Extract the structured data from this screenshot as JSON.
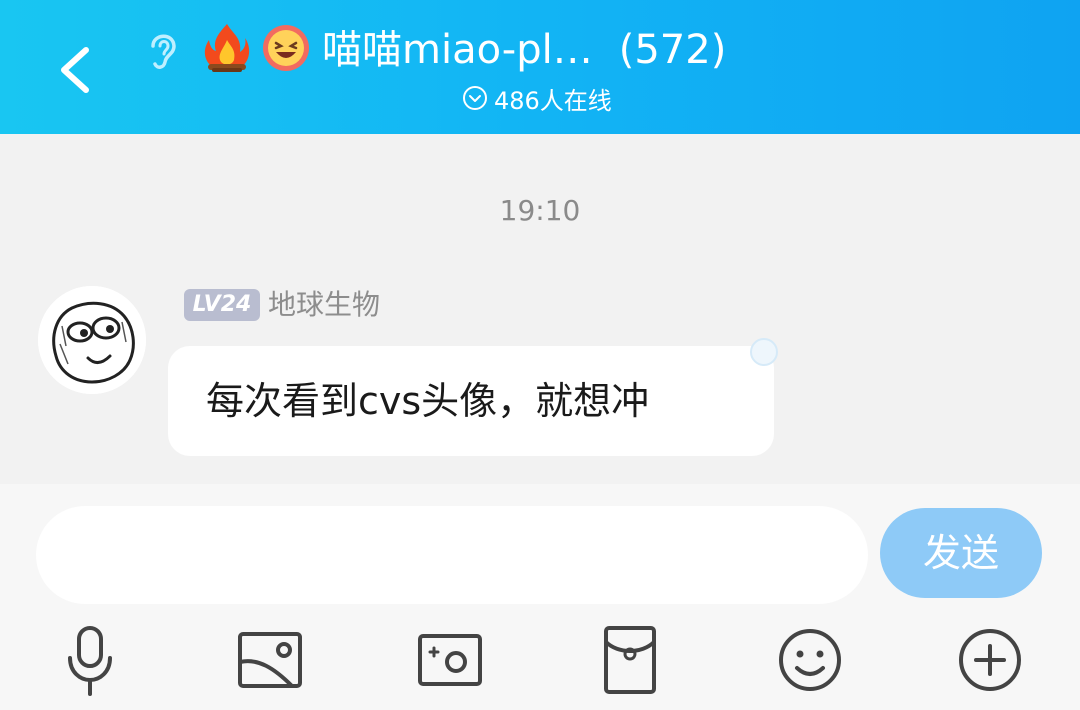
{
  "header": {
    "title": "喵喵miao-pl…",
    "member_count": "(572)",
    "online_text": "486人在线"
  },
  "chat": {
    "timestamp": "19:10",
    "messages": [
      {
        "level_badge": "LV24",
        "sender": "地球生物",
        "text": "每次看到cvs头像，就想冲"
      }
    ]
  },
  "input": {
    "placeholder": "",
    "send_label": "发送"
  },
  "toolbar": [
    "microphone-icon",
    "image-icon",
    "camera-icon",
    "red-envelope-icon",
    "emoji-icon",
    "plus-icon"
  ],
  "colors": {
    "header_start": "#19c6f2",
    "header_end": "#0fa3f2",
    "send_button": "#8ecaf7",
    "level_badge": "#b9bdd0"
  }
}
